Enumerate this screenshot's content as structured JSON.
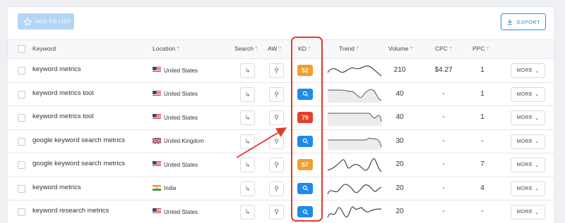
{
  "toolbar": {
    "add_to_list_label": "ADD TO LIST",
    "export_label": "EXPORT"
  },
  "table": {
    "headers": {
      "keyword": "Keyword",
      "location": "Location",
      "search": "Search",
      "aw": "AW",
      "kd": "KD",
      "trend": "Trend",
      "volume": "Volume",
      "cpc": "CPC",
      "ppc": "PPC"
    },
    "more_label": "MORE",
    "rows": [
      {
        "keyword": "keyword metrics",
        "location": "United States",
        "flag": "us",
        "kd": "52",
        "kd_color": "#f0a030",
        "trend": "t1",
        "volume": "210",
        "cpc": "$4.27",
        "ppc": "1"
      },
      {
        "keyword": "keyword metrics tool",
        "location": "United States",
        "flag": "us",
        "kd": "",
        "kd_color": "#1e8bea",
        "trend": "t2",
        "volume": "40",
        "cpc": "-",
        "ppc": "1"
      },
      {
        "keyword": "keyword metrics tool",
        "location": "United States",
        "flag": "us",
        "kd": "79",
        "kd_color": "#e5402a",
        "trend": "t3",
        "volume": "40",
        "cpc": "-",
        "ppc": "1"
      },
      {
        "keyword": "google keyword search metrics",
        "location": "United Kingdom",
        "flag": "uk",
        "kd": "",
        "kd_color": "#1e8bea",
        "trend": "t4",
        "volume": "30",
        "cpc": "-",
        "ppc": "-"
      },
      {
        "keyword": "google keyword search metrics",
        "location": "United States",
        "flag": "us",
        "kd": "57",
        "kd_color": "#f0a030",
        "trend": "t5",
        "volume": "20",
        "cpc": "-",
        "ppc": "7"
      },
      {
        "keyword": "keyword metrics",
        "location": "India",
        "flag": "in",
        "kd": "",
        "kd_color": "#1e8bea",
        "trend": "t6",
        "volume": "20",
        "cpc": "-",
        "ppc": "4"
      },
      {
        "keyword": "keyword research metrics",
        "location": "United States",
        "flag": "us",
        "kd": "",
        "kd_color": "#1e8bea",
        "trend": "t7",
        "volume": "20",
        "cpc": "-",
        "ppc": "-"
      }
    ]
  }
}
